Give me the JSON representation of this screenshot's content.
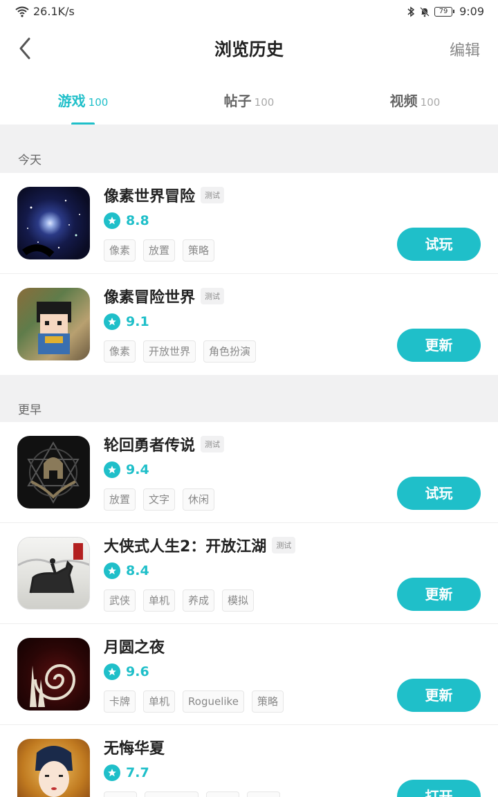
{
  "status_bar": {
    "network_speed": "26.1K/s",
    "battery": "79",
    "time": "9:09"
  },
  "header": {
    "title": "浏览历史",
    "edit_label": "编辑"
  },
  "tabs": [
    {
      "label": "游戏",
      "count": "100",
      "active": true
    },
    {
      "label": "帖子",
      "count": "100",
      "active": false
    },
    {
      "label": "视频",
      "count": "100",
      "active": false
    }
  ],
  "sections": [
    {
      "label": "今天"
    },
    {
      "label": "更早"
    }
  ],
  "games": [
    {
      "name": "像素世界冒险",
      "badge": "测试",
      "score": "8.8",
      "tags": [
        "像素",
        "放置",
        "策略"
      ],
      "button": "试玩"
    },
    {
      "name": "像素冒险世界",
      "badge": "测试",
      "score": "9.1",
      "tags": [
        "像素",
        "开放世界",
        "角色扮演"
      ],
      "button": "更新"
    },
    {
      "name": "轮回勇者传说",
      "badge": "测试",
      "score": "9.4",
      "tags": [
        "放置",
        "文字",
        "休闲"
      ],
      "button": "试玩"
    },
    {
      "name": "大侠式人生2：开放江湖",
      "badge": "测试",
      "score": "8.4",
      "tags": [
        "武侠",
        "单机",
        "养成",
        "模拟"
      ],
      "button": "更新"
    },
    {
      "name": "月圆之夜",
      "badge": "",
      "score": "9.6",
      "tags": [
        "卡牌",
        "单机",
        "Roguelike",
        "策略"
      ],
      "button": "更新"
    },
    {
      "name": "无悔华夏",
      "badge": "",
      "score": "7.7",
      "tags": [
        "",
        "",
        "",
        ""
      ],
      "button": "打开"
    }
  ],
  "colors": {
    "accent": "#1fbfc9",
    "section_bg": "#f1f1f2"
  },
  "icons": [
    "wifi-icon",
    "bluetooth-icon",
    "mute-icon",
    "battery-icon",
    "back-arrow-icon",
    "star-icon"
  ]
}
